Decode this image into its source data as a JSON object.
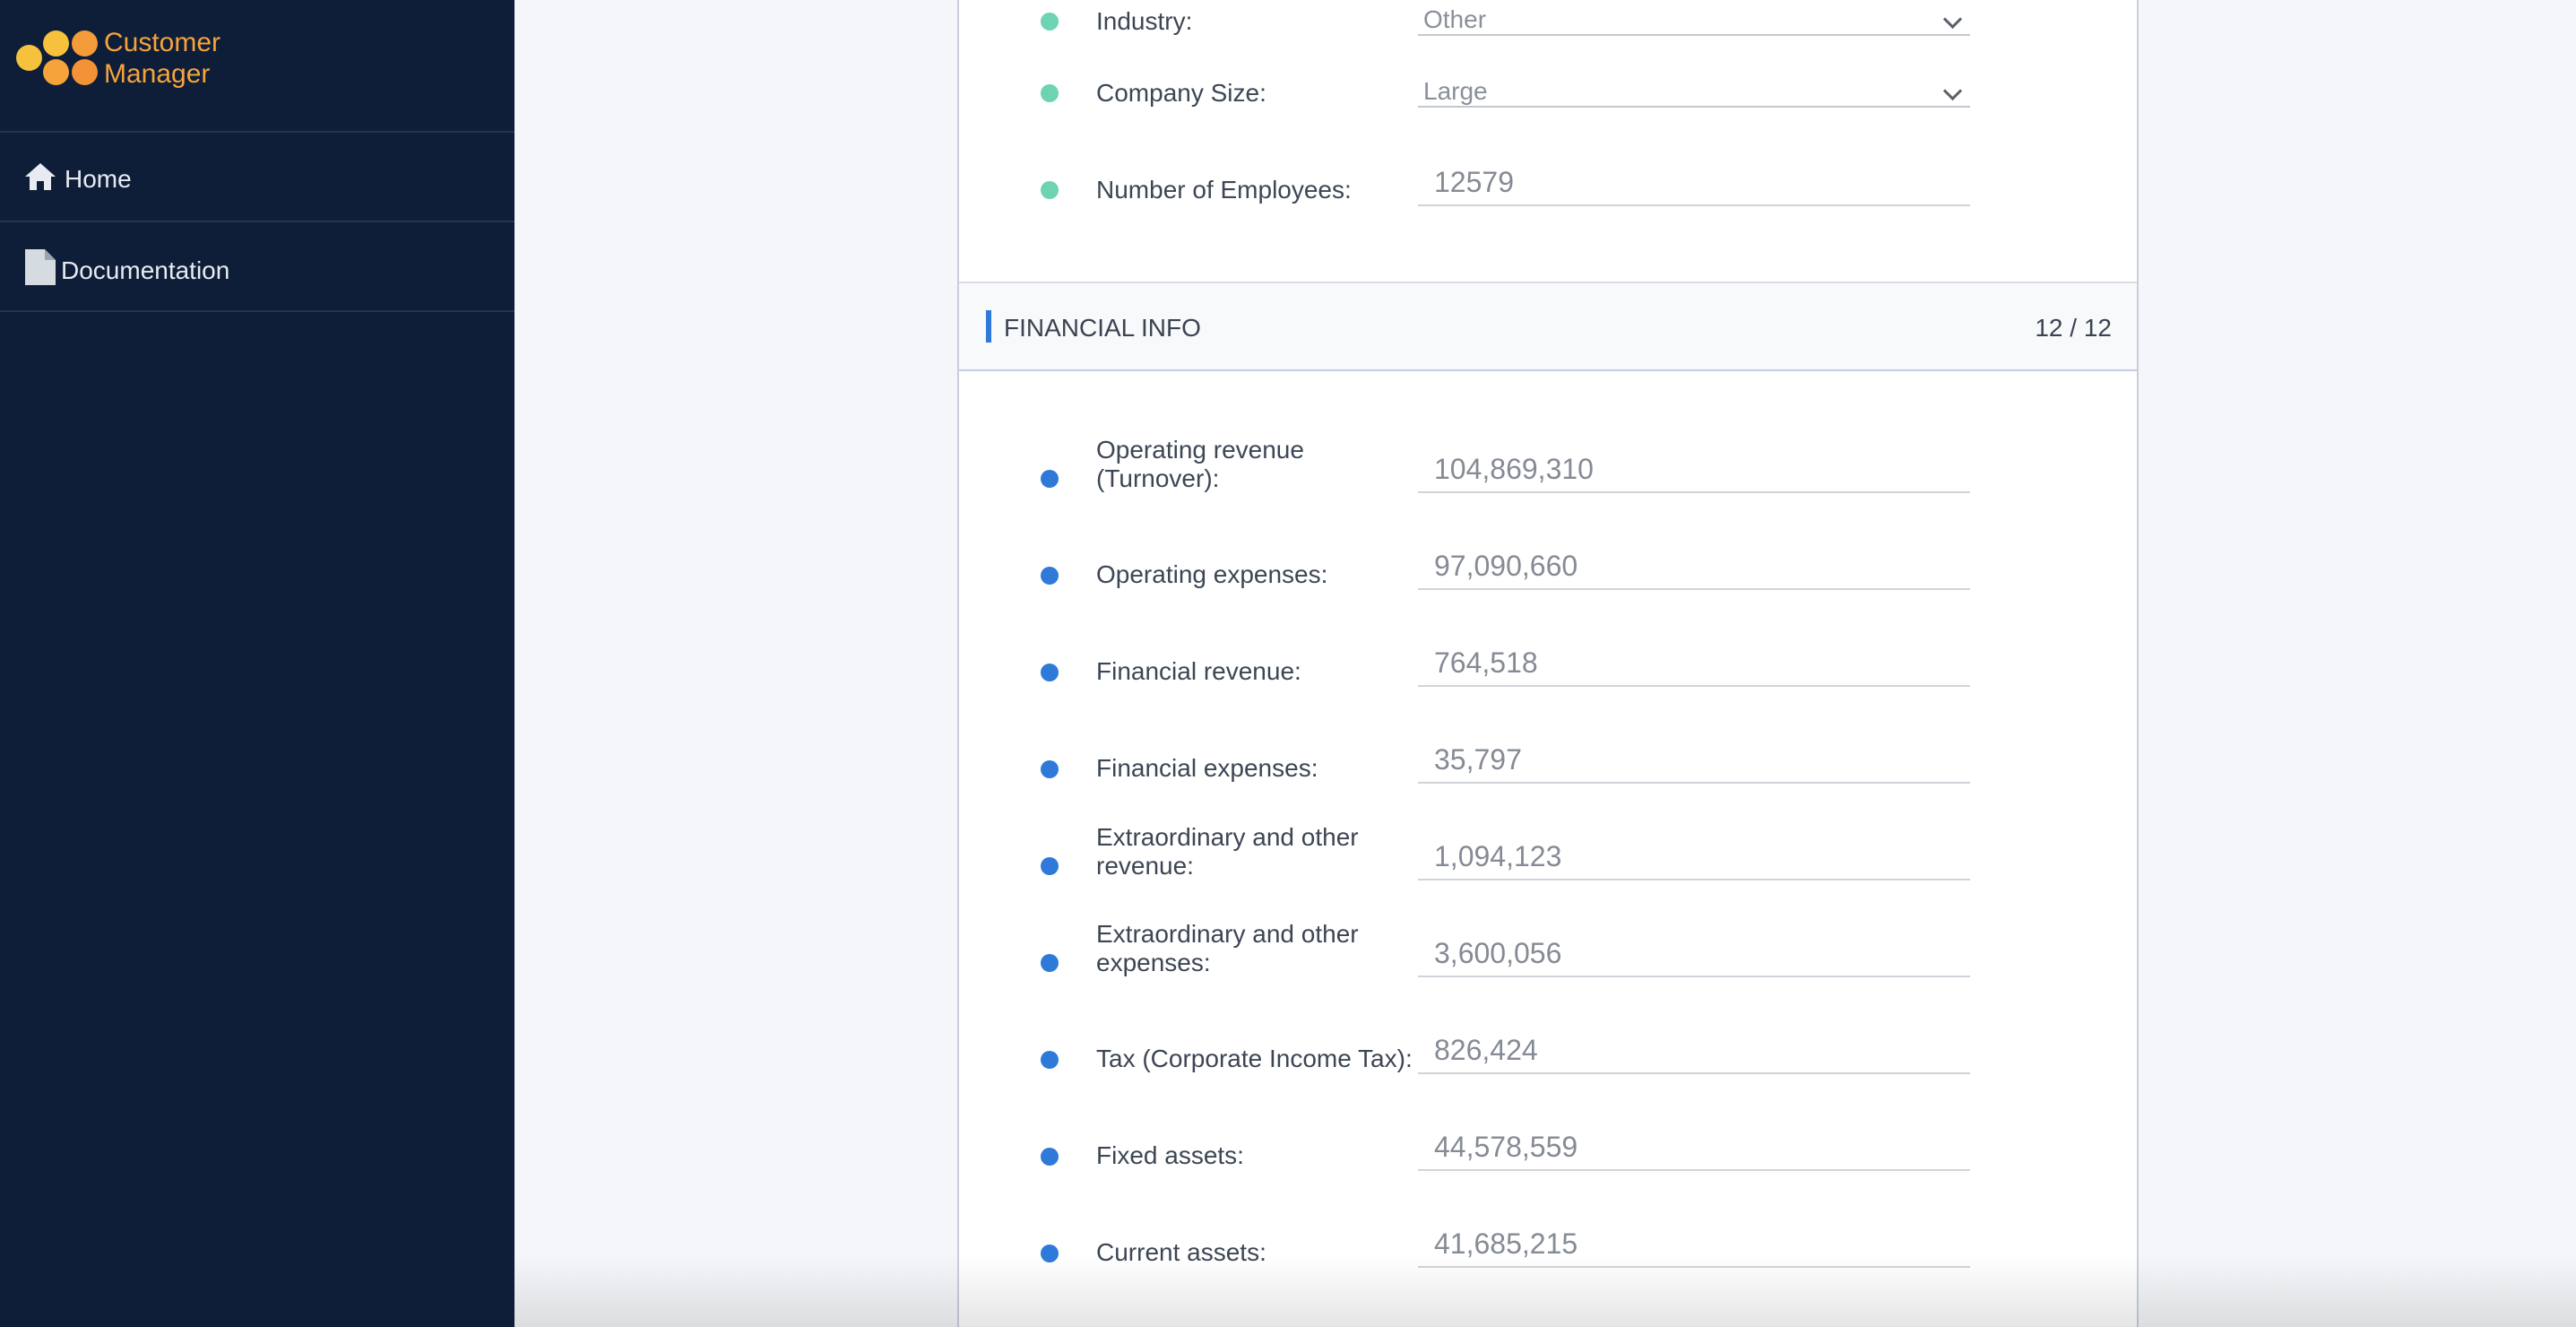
{
  "app": {
    "brand_line1": "Customer",
    "brand_line2": "Manager"
  },
  "nav": {
    "home": "Home",
    "documentation": "Documentation"
  },
  "company": {
    "industry_label": "Industry:",
    "industry_value": "Other",
    "size_label": "Company Size:",
    "size_value": "Large",
    "employees_label": "Number of Employees:",
    "employees_value": "12579"
  },
  "financial": {
    "title": "FINANCIAL INFO",
    "count": "12 / 12",
    "fields": [
      {
        "label": "Operating revenue (Turnover):",
        "value": "104,869,310"
      },
      {
        "label": "Operating expenses:",
        "value": "97,090,660"
      },
      {
        "label": "Financial revenue:",
        "value": "764,518"
      },
      {
        "label": "Financial expenses:",
        "value": "35,797"
      },
      {
        "label": "Extraordinary and other revenue:",
        "value": "1,094,123"
      },
      {
        "label": "Extraordinary and other expenses:",
        "value": "3,600,056"
      },
      {
        "label": "Tax (Corporate Income Tax):",
        "value": "826,424"
      },
      {
        "label": "Fixed assets:",
        "value": "44,578,559"
      },
      {
        "label": "Current assets:",
        "value": "41,685,215"
      }
    ]
  },
  "colors": {
    "sidebar": "#0e1e38",
    "brand": "#f6a33a",
    "accent": "#2f7ad8",
    "status_green": "#6dd3b3"
  }
}
